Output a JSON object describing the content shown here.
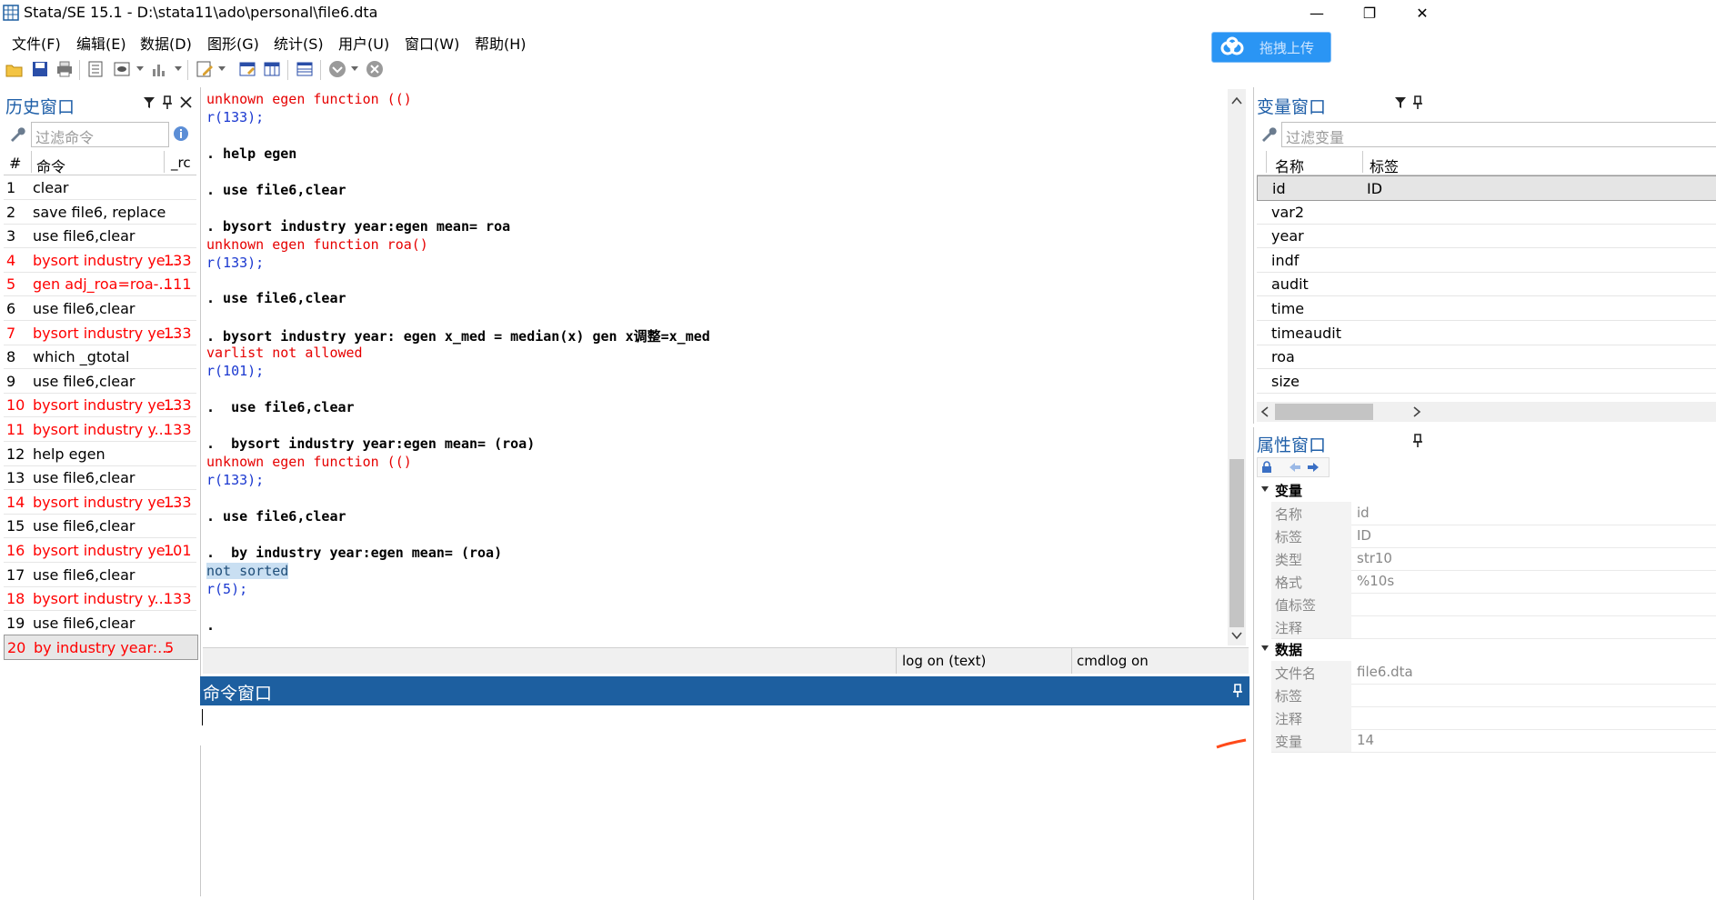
{
  "window": {
    "title": "Stata/SE 15.1 - D:\\stata11\\ado\\personal\\file6.dta",
    "minimize": "—",
    "maximize": "❐",
    "close": "✕"
  },
  "menu": [
    "文件(F)",
    "编辑(E)",
    "数据(D)",
    "图形(G)",
    "统计(S)",
    "用户(U)",
    "窗口(W)",
    "帮助(H)"
  ],
  "upload_button": "拖拽上传",
  "toolbar_icons": [
    "open-icon",
    "save-icon",
    "print-icon",
    "log-icon",
    "viewer-icon",
    "graph-icon",
    "do-file-editor-icon",
    "data-editor-icon",
    "data-browser-icon",
    "variables-manager-icon",
    "more-icon",
    "break-icon"
  ],
  "history": {
    "title": "历史窗口",
    "filter_placeholder": "过滤命令",
    "col_num": "#",
    "col_cmd": "命令",
    "col_rc": "_rc",
    "rows": [
      {
        "n": "1",
        "cmd": "clear",
        "rc": "",
        "err": false
      },
      {
        "n": "2",
        "cmd": "save file6, replace",
        "rc": "",
        "err": false
      },
      {
        "n": "3",
        "cmd": "use file6,clear",
        "rc": "",
        "err": false
      },
      {
        "n": "4",
        "cmd": "bysort industry ye...",
        "rc": "133",
        "err": true
      },
      {
        "n": "5",
        "cmd": "gen adj_roa=roa-...",
        "rc": "111",
        "err": true
      },
      {
        "n": "6",
        "cmd": "use file6,clear",
        "rc": "",
        "err": false
      },
      {
        "n": "7",
        "cmd": "bysort industry ye...",
        "rc": "133",
        "err": true
      },
      {
        "n": "8",
        "cmd": "which _gtotal",
        "rc": "",
        "err": false
      },
      {
        "n": "9",
        "cmd": "use file6,clear",
        "rc": "",
        "err": false
      },
      {
        "n": "10",
        "cmd": "bysort industry ye...",
        "rc": "133",
        "err": true
      },
      {
        "n": "11",
        "cmd": " bysort industry y...",
        "rc": "133",
        "err": true
      },
      {
        "n": "12",
        "cmd": "help egen",
        "rc": "",
        "err": false
      },
      {
        "n": "13",
        "cmd": "use file6,clear",
        "rc": "",
        "err": false
      },
      {
        "n": "14",
        "cmd": "bysort industry ye...",
        "rc": "133",
        "err": true
      },
      {
        "n": "15",
        "cmd": "use file6,clear",
        "rc": "",
        "err": false
      },
      {
        "n": "16",
        "cmd": "bysort industry ye...",
        "rc": "101",
        "err": true
      },
      {
        "n": "17",
        "cmd": " use file6,clear",
        "rc": "",
        "err": false
      },
      {
        "n": "18",
        "cmd": " bysort industry y...",
        "rc": "133",
        "err": true
      },
      {
        "n": "19",
        "cmd": "use file6,clear",
        "rc": "",
        "err": false
      },
      {
        "n": "20",
        "cmd": " by industry year:...",
        "rc": "5",
        "err": true
      }
    ]
  },
  "results": [
    {
      "t": "unknown egen function (()",
      "k": "err"
    },
    {
      "t": "r(133);",
      "k": "ret"
    },
    {
      "t": "",
      "k": "cmdline"
    },
    {
      "t": ". help egen",
      "k": "cmdline"
    },
    {
      "t": "",
      "k": "cmdline"
    },
    {
      "t": ". use file6,clear",
      "k": "cmdline"
    },
    {
      "t": "",
      "k": "cmdline"
    },
    {
      "t": ". bysort industry year:egen mean= roa",
      "k": "cmdline"
    },
    {
      "t": "unknown egen function roa()",
      "k": "err"
    },
    {
      "t": "r(133);",
      "k": "ret"
    },
    {
      "t": "",
      "k": "cmdline"
    },
    {
      "t": ". use file6,clear",
      "k": "cmdline"
    },
    {
      "t": "",
      "k": "cmdline"
    },
    {
      "t": ". bysort industry year: egen x_med = median(x) gen x调整=x_med",
      "k": "cmdline"
    },
    {
      "t": "varlist not allowed",
      "k": "err"
    },
    {
      "t": "r(101);",
      "k": "ret"
    },
    {
      "t": "",
      "k": "cmdline"
    },
    {
      "t": ".  use file6,clear",
      "k": "cmdline"
    },
    {
      "t": "",
      "k": "cmdline"
    },
    {
      "t": ".  bysort industry year:egen mean= (roa)",
      "k": "cmdline"
    },
    {
      "t": "unknown egen function (()",
      "k": "err"
    },
    {
      "t": "r(133);",
      "k": "ret"
    },
    {
      "t": "",
      "k": "cmdline"
    },
    {
      "t": ". use file6,clear",
      "k": "cmdline"
    },
    {
      "t": "",
      "k": "cmdline"
    },
    {
      "t": ".  by industry year:egen mean= (roa)",
      "k": "cmdline"
    },
    {
      "t": "not sorted",
      "k": "plain"
    },
    {
      "t": "r(5);",
      "k": "ret"
    },
    {
      "t": "",
      "k": "cmdline"
    },
    {
      "t": ".",
      "k": "cmdline"
    }
  ],
  "status": {
    "log": "log on (text)",
    "cmdlog": "cmdlog on"
  },
  "command_window": {
    "title": "命令窗口",
    "value": ""
  },
  "variables": {
    "title": "变量窗口",
    "filter_placeholder": "过滤变量",
    "col_name": "名称",
    "col_label": "标签",
    "rows": [
      {
        "name": "id",
        "label": "ID"
      },
      {
        "name": "var2",
        "label": ""
      },
      {
        "name": "year",
        "label": ""
      },
      {
        "name": "indf",
        "label": ""
      },
      {
        "name": "audit",
        "label": ""
      },
      {
        "name": "time",
        "label": ""
      },
      {
        "name": "timeaudit",
        "label": ""
      },
      {
        "name": "roa",
        "label": ""
      },
      {
        "name": "size",
        "label": ""
      }
    ]
  },
  "properties": {
    "title": "属性窗口",
    "var_section": "变量",
    "var_rows": [
      {
        "k": "名称",
        "v": "id"
      },
      {
        "k": "标签",
        "v": "ID"
      },
      {
        "k": "类型",
        "v": "str10"
      },
      {
        "k": "格式",
        "v": "%10s"
      },
      {
        "k": "值标签",
        "v": ""
      },
      {
        "k": "注释",
        "v": ""
      }
    ],
    "data_section": "数据",
    "data_rows": [
      {
        "k": "文件名",
        "v": "file6.dta"
      },
      {
        "k": "标签",
        "v": ""
      },
      {
        "k": "注释",
        "v": ""
      },
      {
        "k": "变量",
        "v": "14"
      }
    ]
  }
}
